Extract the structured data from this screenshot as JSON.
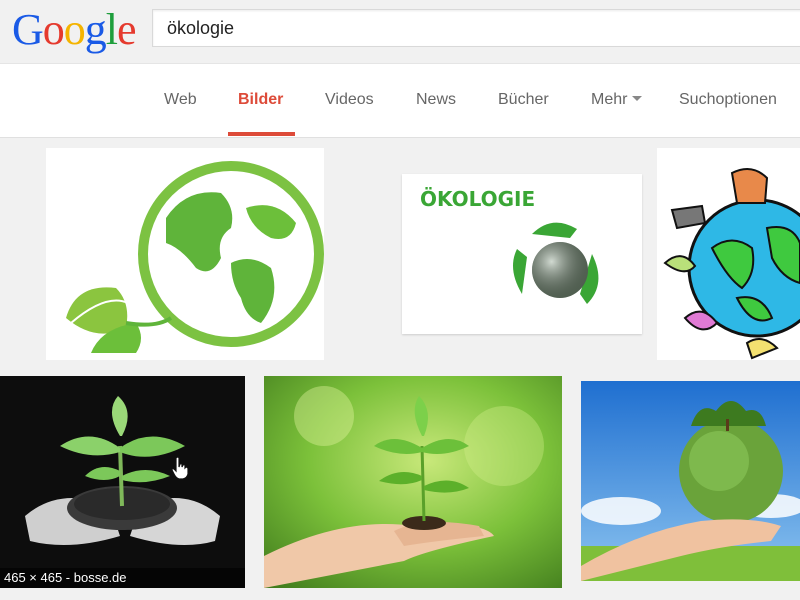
{
  "header": {
    "logo_letters": [
      {
        "char": "G",
        "color": "#1a5ae6"
      },
      {
        "char": "o",
        "color": "#e53a2e"
      },
      {
        "char": "o",
        "color": "#f4b400"
      },
      {
        "char": "g",
        "color": "#1a5ae6"
      },
      {
        "char": "l",
        "color": "#1e9e3c"
      },
      {
        "char": "e",
        "color": "#e53a2e"
      }
    ],
    "search_value": "ökologie"
  },
  "tabs": [
    {
      "label": "Web",
      "active": false
    },
    {
      "label": "Bilder",
      "active": true
    },
    {
      "label": "Videos",
      "active": false
    },
    {
      "label": "News",
      "active": false
    },
    {
      "label": "Bücher",
      "active": false
    },
    {
      "label": "Mehr",
      "active": false,
      "dropdown": true
    },
    {
      "label": "Suchoptionen",
      "active": false
    }
  ],
  "images": [
    {
      "subject": "green globe with leaf illustration"
    },
    {
      "subject": "recycling symbol with earth",
      "title_text": "ÖKOLOGIE"
    },
    {
      "subject": "cartoon earth with animals"
    },
    {
      "subject": "seedling in soil held by hands, black and white",
      "caption": "465 × 465 - bosse.de",
      "hovered": true
    },
    {
      "subject": "hands holding green seedling"
    },
    {
      "subject": "hand holding green globe with trees"
    }
  ],
  "colors": {
    "accent": "#dd4b39",
    "tab_text": "#666666",
    "background": "#f1f1f1"
  },
  "icons": {
    "mehr_dropdown": "caret-down-icon",
    "cursor": "hand-pointer-icon"
  }
}
